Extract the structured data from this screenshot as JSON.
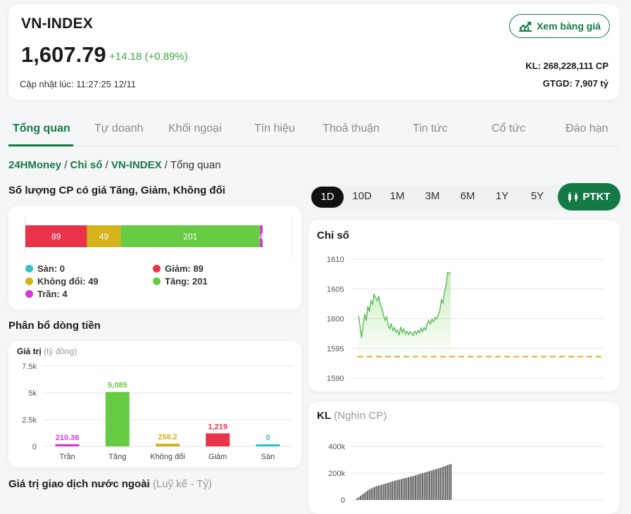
{
  "header": {
    "title": "VN-INDEX",
    "price": "1,607.79",
    "change": "+14.18 (+0.89%)",
    "updated": "Cập nhật lúc: 11:27:25 12/11",
    "board_button": "Xem bảng giá",
    "volume": "KL: 268,228,111 CP",
    "value": "GTGD: 7,907 tỷ",
    "up_color": "#3ea53e",
    "brand_color": "#147a45"
  },
  "tabs": [
    "Tổng quan",
    "Tự doanh",
    "Khối ngoại",
    "Tín hiệu",
    "Thoả thuận",
    "Tin tức",
    "Cổ tức",
    "Đáo hạn"
  ],
  "breadcrumb": {
    "home": "24HMoney",
    "sep": " / ",
    "index": "Chỉ số",
    "symbol": "VN-INDEX",
    "current": "Tổng quan"
  },
  "counts": {
    "title": "Số lượng CP có giá Tăng, Giảm, Không đổi",
    "bar": [
      {
        "label": "0",
        "value": 0,
        "color": "#2ec4c4"
      },
      {
        "label": "89",
        "value": 89,
        "color": "#e8334a"
      },
      {
        "label": "49",
        "value": 49,
        "color": "#d6b21b"
      },
      {
        "label": "201",
        "value": 201,
        "color": "#66cc44"
      },
      {
        "label": "4",
        "value": 4,
        "color": "#d63ad6"
      }
    ],
    "legend": {
      "san": "Sàn: 0",
      "giam": "Giảm: 89",
      "khongdoi": "Không đổi: 49",
      "tang": "Tăng: 201",
      "tran": "Trần: 4"
    }
  },
  "flow": {
    "title": "Phân bổ dòng tiền",
    "axis_title": "Giá trị",
    "axis_unit": "(tỷ đồng)"
  },
  "foreign": {
    "title": "Giá trị giao dịch nước ngoài",
    "unit": "(Luỹ kế - Tỷ)"
  },
  "periods": [
    "1D",
    "10D",
    "1M",
    "3M",
    "6M",
    "1Y",
    "5Y"
  ],
  "ptkt_label": "PTKT",
  "index_chart": {
    "title": "Chỉ số"
  },
  "volume_chart": {
    "title": "KL",
    "unit": "(Nghìn CP)"
  },
  "chart_data": [
    {
      "type": "bar",
      "categories": [
        "Trần",
        "Tăng",
        "Không đổi",
        "Giảm",
        "Sàn"
      ],
      "values": [
        210.36,
        5085,
        258.2,
        1219,
        0
      ],
      "labels": [
        "210.36",
        "5,085",
        "258.2",
        "1,219",
        "0"
      ],
      "colors": [
        "#d63ad6",
        "#66cc44",
        "#d6b21b",
        "#e8334a",
        "#2ec4c4"
      ],
      "yticks": [
        "7.5k",
        "5k",
        "2.5k",
        "0"
      ],
      "ylim": [
        0,
        7500
      ]
    },
    {
      "type": "line",
      "title": "Chỉ số",
      "yticks": [
        1610,
        1605,
        1600,
        1595,
        1590
      ],
      "ylim": [
        1590,
        1610
      ],
      "reference": 1593.61,
      "y": [
        1600.5,
        1598.9,
        1596.8,
        1599,
        1600.8,
        1599.6,
        1602.1,
        1601.2,
        1603,
        1602.4,
        1604.1,
        1603.5,
        1603,
        1603.8,
        1602.2,
        1601.8,
        1600.6,
        1599.7,
        1600.3,
        1598.9,
        1598.3,
        1599.2,
        1598,
        1598.5,
        1597.7,
        1598.1,
        1597.2,
        1598.6,
        1597.6,
        1598.3,
        1597.4,
        1597.9,
        1597.3,
        1597.8,
        1597.5,
        1597.2,
        1597.9,
        1597.4,
        1598,
        1597.6,
        1598.4,
        1597.8,
        1598.5,
        1598.1,
        1599.2,
        1599.7,
        1599.1,
        1599.9,
        1599.5,
        1600.2,
        1599.9,
        1600.6,
        1601.3,
        1603.2,
        1602.6,
        1604.6,
        1605.5,
        1607.7,
        1607.6,
        1607.8
      ]
    },
    {
      "type": "bar",
      "title": "KL",
      "yticks": [
        "400k",
        "200k",
        "0"
      ],
      "ylim": [
        0,
        400000
      ],
      "values": [
        12000,
        20000,
        30000,
        42000,
        50000,
        60000,
        70000,
        78000,
        85000,
        92000,
        98000,
        102000,
        106000,
        110000,
        114000,
        118000,
        122000,
        126000,
        130000,
        134000,
        138000,
        142000,
        146000,
        149000,
        152000,
        156000,
        160000,
        163000,
        166000,
        170000,
        173000,
        176000,
        180000,
        184000,
        188000,
        192000,
        196000,
        200000,
        204000,
        208000,
        212000,
        216000,
        220000,
        224000,
        228000,
        232000,
        236000,
        240000,
        245000,
        250000,
        255000,
        260000,
        265000,
        268000
      ]
    }
  ]
}
